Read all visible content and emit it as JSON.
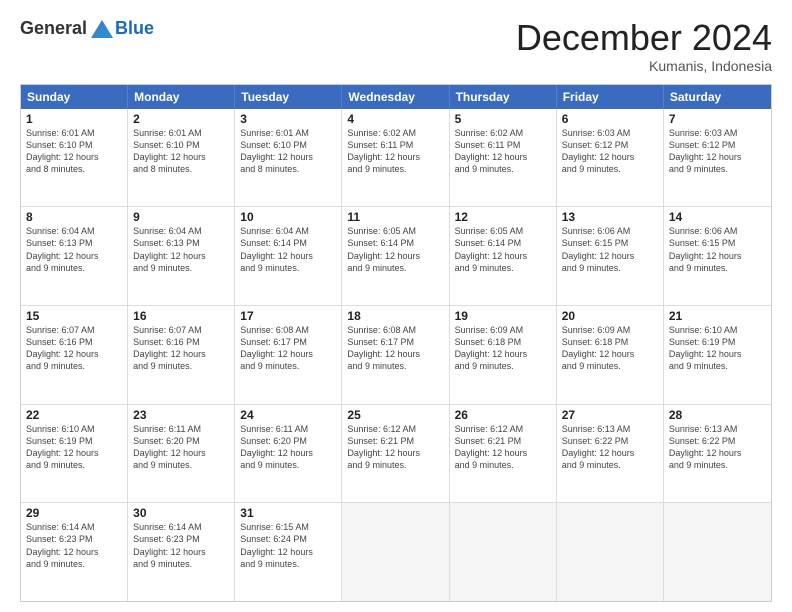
{
  "logo": {
    "general": "General",
    "blue": "Blue"
  },
  "title": "December 2024",
  "subtitle": "Kumanis, Indonesia",
  "header_days": [
    "Sunday",
    "Monday",
    "Tuesday",
    "Wednesday",
    "Thursday",
    "Friday",
    "Saturday"
  ],
  "weeks": [
    [
      {
        "day": "1",
        "lines": [
          "Sunrise: 6:01 AM",
          "Sunset: 6:10 PM",
          "Daylight: 12 hours",
          "and 8 minutes."
        ]
      },
      {
        "day": "2",
        "lines": [
          "Sunrise: 6:01 AM",
          "Sunset: 6:10 PM",
          "Daylight: 12 hours",
          "and 8 minutes."
        ]
      },
      {
        "day": "3",
        "lines": [
          "Sunrise: 6:01 AM",
          "Sunset: 6:10 PM",
          "Daylight: 12 hours",
          "and 8 minutes."
        ]
      },
      {
        "day": "4",
        "lines": [
          "Sunrise: 6:02 AM",
          "Sunset: 6:11 PM",
          "Daylight: 12 hours",
          "and 9 minutes."
        ]
      },
      {
        "day": "5",
        "lines": [
          "Sunrise: 6:02 AM",
          "Sunset: 6:11 PM",
          "Daylight: 12 hours",
          "and 9 minutes."
        ]
      },
      {
        "day": "6",
        "lines": [
          "Sunrise: 6:03 AM",
          "Sunset: 6:12 PM",
          "Daylight: 12 hours",
          "and 9 minutes."
        ]
      },
      {
        "day": "7",
        "lines": [
          "Sunrise: 6:03 AM",
          "Sunset: 6:12 PM",
          "Daylight: 12 hours",
          "and 9 minutes."
        ]
      }
    ],
    [
      {
        "day": "8",
        "lines": [
          "Sunrise: 6:04 AM",
          "Sunset: 6:13 PM",
          "Daylight: 12 hours",
          "and 9 minutes."
        ]
      },
      {
        "day": "9",
        "lines": [
          "Sunrise: 6:04 AM",
          "Sunset: 6:13 PM",
          "Daylight: 12 hours",
          "and 9 minutes."
        ]
      },
      {
        "day": "10",
        "lines": [
          "Sunrise: 6:04 AM",
          "Sunset: 6:14 PM",
          "Daylight: 12 hours",
          "and 9 minutes."
        ]
      },
      {
        "day": "11",
        "lines": [
          "Sunrise: 6:05 AM",
          "Sunset: 6:14 PM",
          "Daylight: 12 hours",
          "and 9 minutes."
        ]
      },
      {
        "day": "12",
        "lines": [
          "Sunrise: 6:05 AM",
          "Sunset: 6:14 PM",
          "Daylight: 12 hours",
          "and 9 minutes."
        ]
      },
      {
        "day": "13",
        "lines": [
          "Sunrise: 6:06 AM",
          "Sunset: 6:15 PM",
          "Daylight: 12 hours",
          "and 9 minutes."
        ]
      },
      {
        "day": "14",
        "lines": [
          "Sunrise: 6:06 AM",
          "Sunset: 6:15 PM",
          "Daylight: 12 hours",
          "and 9 minutes."
        ]
      }
    ],
    [
      {
        "day": "15",
        "lines": [
          "Sunrise: 6:07 AM",
          "Sunset: 6:16 PM",
          "Daylight: 12 hours",
          "and 9 minutes."
        ]
      },
      {
        "day": "16",
        "lines": [
          "Sunrise: 6:07 AM",
          "Sunset: 6:16 PM",
          "Daylight: 12 hours",
          "and 9 minutes."
        ]
      },
      {
        "day": "17",
        "lines": [
          "Sunrise: 6:08 AM",
          "Sunset: 6:17 PM",
          "Daylight: 12 hours",
          "and 9 minutes."
        ]
      },
      {
        "day": "18",
        "lines": [
          "Sunrise: 6:08 AM",
          "Sunset: 6:17 PM",
          "Daylight: 12 hours",
          "and 9 minutes."
        ]
      },
      {
        "day": "19",
        "lines": [
          "Sunrise: 6:09 AM",
          "Sunset: 6:18 PM",
          "Daylight: 12 hours",
          "and 9 minutes."
        ]
      },
      {
        "day": "20",
        "lines": [
          "Sunrise: 6:09 AM",
          "Sunset: 6:18 PM",
          "Daylight: 12 hours",
          "and 9 minutes."
        ]
      },
      {
        "day": "21",
        "lines": [
          "Sunrise: 6:10 AM",
          "Sunset: 6:19 PM",
          "Daylight: 12 hours",
          "and 9 minutes."
        ]
      }
    ],
    [
      {
        "day": "22",
        "lines": [
          "Sunrise: 6:10 AM",
          "Sunset: 6:19 PM",
          "Daylight: 12 hours",
          "and 9 minutes."
        ]
      },
      {
        "day": "23",
        "lines": [
          "Sunrise: 6:11 AM",
          "Sunset: 6:20 PM",
          "Daylight: 12 hours",
          "and 9 minutes."
        ]
      },
      {
        "day": "24",
        "lines": [
          "Sunrise: 6:11 AM",
          "Sunset: 6:20 PM",
          "Daylight: 12 hours",
          "and 9 minutes."
        ]
      },
      {
        "day": "25",
        "lines": [
          "Sunrise: 6:12 AM",
          "Sunset: 6:21 PM",
          "Daylight: 12 hours",
          "and 9 minutes."
        ]
      },
      {
        "day": "26",
        "lines": [
          "Sunrise: 6:12 AM",
          "Sunset: 6:21 PM",
          "Daylight: 12 hours",
          "and 9 minutes."
        ]
      },
      {
        "day": "27",
        "lines": [
          "Sunrise: 6:13 AM",
          "Sunset: 6:22 PM",
          "Daylight: 12 hours",
          "and 9 minutes."
        ]
      },
      {
        "day": "28",
        "lines": [
          "Sunrise: 6:13 AM",
          "Sunset: 6:22 PM",
          "Daylight: 12 hours",
          "and 9 minutes."
        ]
      }
    ],
    [
      {
        "day": "29",
        "lines": [
          "Sunrise: 6:14 AM",
          "Sunset: 6:23 PM",
          "Daylight: 12 hours",
          "and 9 minutes."
        ]
      },
      {
        "day": "30",
        "lines": [
          "Sunrise: 6:14 AM",
          "Sunset: 6:23 PM",
          "Daylight: 12 hours",
          "and 9 minutes."
        ]
      },
      {
        "day": "31",
        "lines": [
          "Sunrise: 6:15 AM",
          "Sunset: 6:24 PM",
          "Daylight: 12 hours",
          "and 9 minutes."
        ]
      },
      {
        "day": "",
        "lines": []
      },
      {
        "day": "",
        "lines": []
      },
      {
        "day": "",
        "lines": []
      },
      {
        "day": "",
        "lines": []
      }
    ]
  ]
}
